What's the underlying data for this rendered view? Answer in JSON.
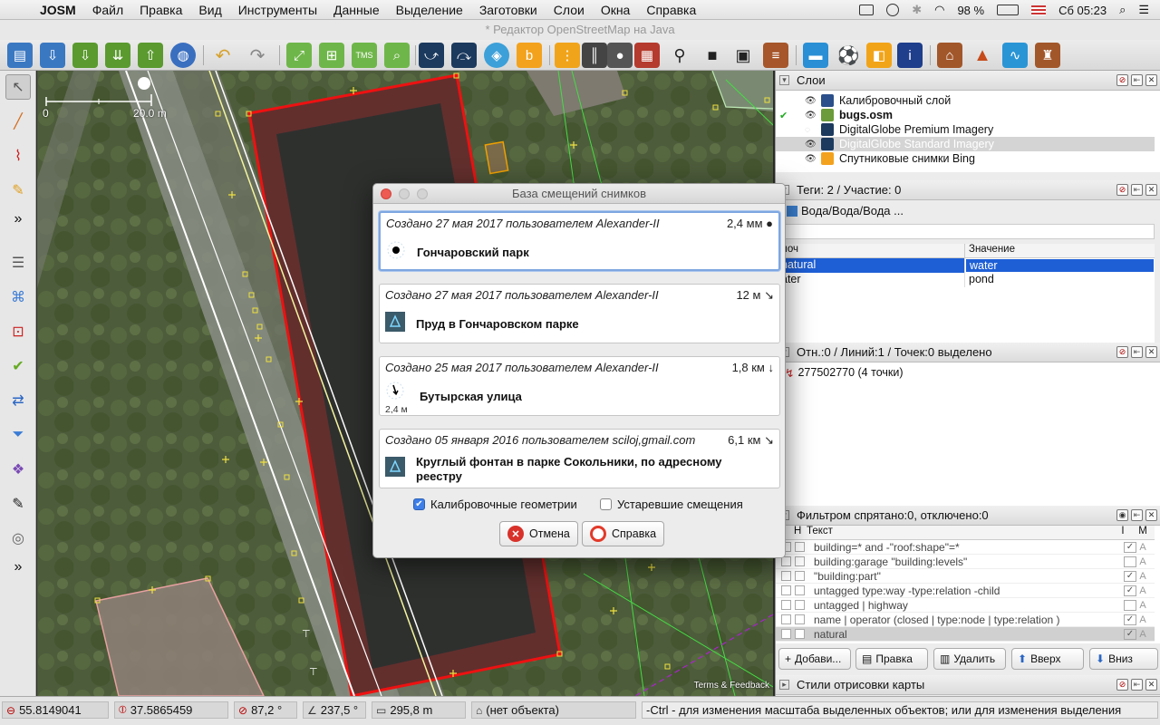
{
  "menubar": {
    "app": "JOSM",
    "items": [
      "Файл",
      "Правка",
      "Вид",
      "Инструменты",
      "Данные",
      "Выделение",
      "Заготовки",
      "Слои",
      "Окна",
      "Справка"
    ],
    "battery": "98 %",
    "clock": "Сб 05:23"
  },
  "window": {
    "title": "* Редактор OpenStreetMap на Java"
  },
  "map": {
    "scale_zero": "0",
    "scale_label": "20.0 m",
    "terms": "Terms & Feedback"
  },
  "layers_panel": {
    "title": "Слои",
    "layers": [
      {
        "name": "Калибровочный слой",
        "bold": false,
        "selected": false,
        "active": false
      },
      {
        "name": "bugs.osm",
        "bold": true,
        "selected": false,
        "active": true
      },
      {
        "name": "DigitalGlobe Premium Imagery",
        "bold": false,
        "selected": false,
        "active": false
      },
      {
        "name": "DigitalGlobe Standard Imagery",
        "bold": false,
        "selected": true,
        "active": false
      },
      {
        "name": "Спутниковые снимки Bing",
        "bold": false,
        "selected": false,
        "active": false
      }
    ]
  },
  "tags_panel": {
    "title": "Теги: 2 / Участие: 0",
    "preset": "Вода/Вода/Вода ...",
    "col_key": "лоч",
    "col_value": "Значение",
    "rows": [
      {
        "key": "natural",
        "value": "water"
      },
      {
        "key": "ater",
        "value": "pond"
      }
    ]
  },
  "selection_panel": {
    "title": "Отн.:0 / Линий:1 / Точек:0 выделено",
    "item": "277502770 (4 точки)"
  },
  "filter_panel": {
    "title": "Фильтром спрятано:0, отключено:0",
    "col_h": "Н",
    "col_text": "Текст",
    "col_i": "I",
    "col_m": "M",
    "rows": [
      {
        "text": "building=* and -\"roof:shape\"=*",
        "i": "✓",
        "m": "A"
      },
      {
        "text": "building:garage \"building:levels\"",
        "i": "",
        "m": "A"
      },
      {
        "text": "\"building:part\"",
        "i": "✓",
        "m": "A"
      },
      {
        "text": "untagged type:way -type:relation  -child",
        "i": "✓",
        "m": "A"
      },
      {
        "text": "untagged | highway",
        "i": "",
        "m": "A"
      },
      {
        "text": "name | operator (closed |  type:node |  type:relation )",
        "i": "✓",
        "m": "A"
      },
      {
        "text": "natural",
        "i": "✓",
        "m": "A"
      }
    ],
    "buttons": {
      "add": "Добави...",
      "edit": "Правка",
      "delete": "Удалить",
      "up": "Вверх",
      "down": "Вниз"
    }
  },
  "styles_panel": {
    "title": "Стили отрисовки карты"
  },
  "dialog": {
    "title": "База смещений снимков",
    "offsets": [
      {
        "header": "Создано 27 мая 2017 пользователем Alexander-II",
        "distance": "2,4 мм",
        "arrow": "●",
        "name": "Гончаровский парк",
        "sub": "",
        "icon": "dot"
      },
      {
        "header": "Создано 27 мая 2017 пользователем Alexander-II",
        "distance": "12 м",
        "arrow": "↘",
        "name": "Пруд в Гончаровском парке",
        "sub": "",
        "icon": "geom"
      },
      {
        "header": "Создано 25 мая 2017 пользователем Alexander-II",
        "distance": "1,8 км",
        "arrow": "↓",
        "name": "Бутырская улица",
        "sub": "2,4 м",
        "icon": "arrow"
      },
      {
        "header": "Создано 05 января 2016 пользователем sciloj,gmail.com",
        "distance": "6,1 км",
        "arrow": "↘",
        "name": "Круглый фонтан в парке Сокольники, по адресному реестру",
        "sub": "",
        "icon": "geom"
      }
    ],
    "checkbox_geometries": "Калибровочные геометрии",
    "checkbox_deprecated": "Устаревшие смещения",
    "cancel": "Отмена",
    "help": "Справка"
  },
  "statusbar": {
    "lat": "55.8149041",
    "lon": "37.5865459",
    "heading": "87,2 °",
    "angle": "237,5 °",
    "distance": "295,8 m",
    "object": "(нет объекта)",
    "help": "-Ctrl - для изменения масштаба выделенных объектов; или для изменения выделения"
  }
}
